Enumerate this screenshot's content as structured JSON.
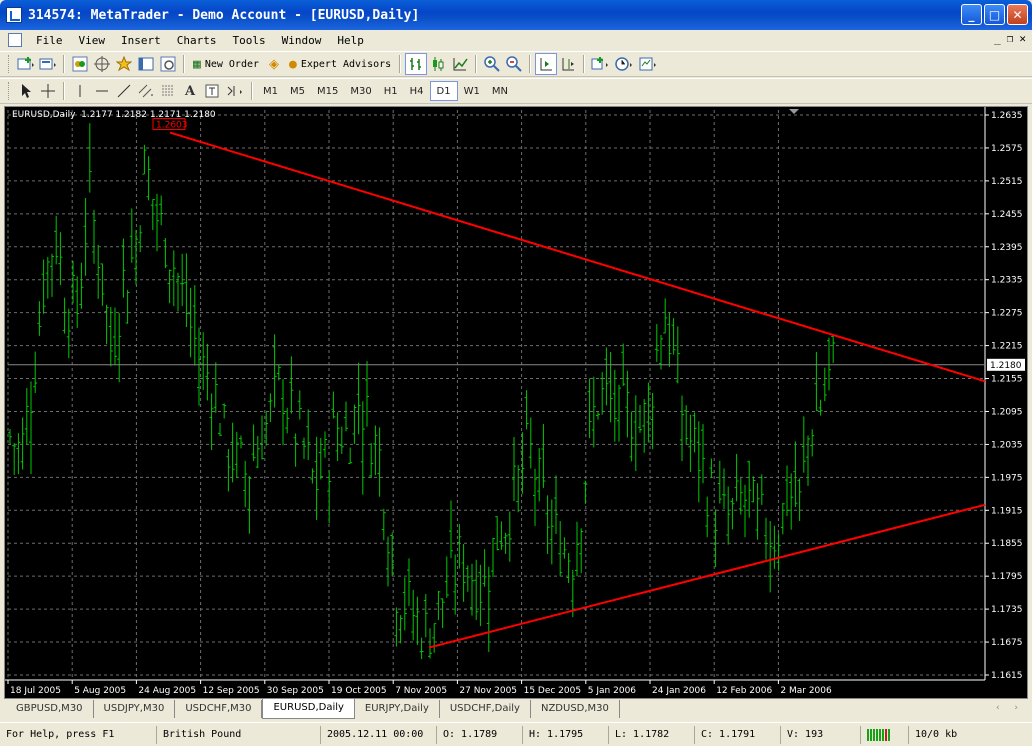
{
  "window": {
    "title": "314574: MetaTrader - Demo Account - [EURUSD,Daily]",
    "minimize": "_",
    "maximize": "□",
    "close": "✕"
  },
  "menu": {
    "items": [
      "File",
      "View",
      "Insert",
      "Charts",
      "Tools",
      "Window",
      "Help"
    ],
    "mdi_minimize": "_",
    "mdi_restore": "❐",
    "mdi_close": "✕"
  },
  "toolbar": {
    "new_order": "New Order",
    "expert_advisors": "Expert Advisors",
    "timeframes": [
      "M1",
      "M5",
      "M15",
      "M30",
      "H1",
      "H4",
      "D1",
      "W1",
      "MN"
    ],
    "active_timeframe": "D1"
  },
  "chart": {
    "info": "EURUSD,Daily  1.2177 1.2182 1.2171 1.2180",
    "high_label": "1.2603",
    "current_price": "1.2180",
    "price_labels": [
      "1.2635",
      "1.2575",
      "1.2515",
      "1.2455",
      "1.2395",
      "1.2335",
      "1.2275",
      "1.2215",
      "1.2155",
      "1.2095",
      "1.2035",
      "1.1975",
      "1.1915",
      "1.1855",
      "1.1795",
      "1.1735",
      "1.1675",
      "1.1615"
    ],
    "date_labels": [
      "18 Jul 2005",
      "5 Aug 2005",
      "24 Aug 2005",
      "12 Sep 2005",
      "30 Sep 2005",
      "19 Oct 2005",
      "7 Nov 2005",
      "27 Nov 2005",
      "15 Dec 2005",
      "5 Jan 2006",
      "24 Jan 2006",
      "12 Feb 2006",
      "2 Mar 2006"
    ],
    "colors": {
      "background": "#000000",
      "bars": "#00c800",
      "grid": "#6e6e6e",
      "trendline": "#ff0000",
      "text": "#ffffff"
    }
  },
  "chart_data": {
    "type": "ohlc",
    "symbol": "EURUSD",
    "timeframe": "Daily",
    "last": {
      "open": 1.2177,
      "high": 1.2182,
      "low": 1.2171,
      "close": 1.218
    },
    "ylim": [
      1.1615,
      1.2635
    ],
    "marked_high": 1.2603,
    "trendlines": [
      {
        "from": [
          "24 Aug 2005",
          1.2603
        ],
        "to": [
          "end",
          1.215
        ]
      },
      {
        "from": [
          "7 Nov 2005",
          1.1665
        ],
        "to": [
          "end",
          1.1925
        ]
      }
    ],
    "close_path": [
      1.205,
      1.202,
      1.215,
      1.233,
      1.242,
      1.23,
      1.228,
      1.249,
      1.237,
      1.22,
      1.233,
      1.238,
      1.255,
      1.245,
      1.24,
      1.233,
      1.225,
      1.218,
      1.215,
      1.205,
      1.2,
      1.198,
      1.204,
      1.208,
      1.215,
      1.208,
      1.203,
      1.196,
      1.2,
      1.207,
      1.205,
      1.212,
      1.206,
      1.2,
      1.179,
      1.175,
      1.172,
      1.169,
      1.174,
      1.178,
      1.183,
      1.18,
      1.177,
      1.186,
      1.19,
      1.196,
      1.203,
      1.195,
      1.188,
      1.185,
      1.183,
      1.198,
      1.212,
      1.212,
      1.208,
      1.21,
      1.206,
      1.215,
      1.229,
      1.217,
      1.205,
      1.202,
      1.195,
      1.19,
      1.19,
      1.194,
      1.191,
      1.188,
      1.187,
      1.195,
      1.192,
      1.208,
      1.211,
      1.218
    ]
  },
  "tabs": {
    "items": [
      "GBPUSD,M30",
      "USDJPY,M30",
      "USDCHF,M30",
      "EURUSD,Daily",
      "EURJPY,Daily",
      "USDCHF,Daily",
      "NZDUSD,M30"
    ],
    "active": "EURUSD,Daily",
    "nav": "‹ ›"
  },
  "status": {
    "help": "For Help, press F1",
    "profile": "British Pound",
    "datetime": "2005.12.11 00:00",
    "open": "O: 1.1789",
    "high": "H: 1.1795",
    "low": "L: 1.1782",
    "close": "C: 1.1791",
    "volume": "V: 193",
    "traffic": "10/0 kb"
  }
}
